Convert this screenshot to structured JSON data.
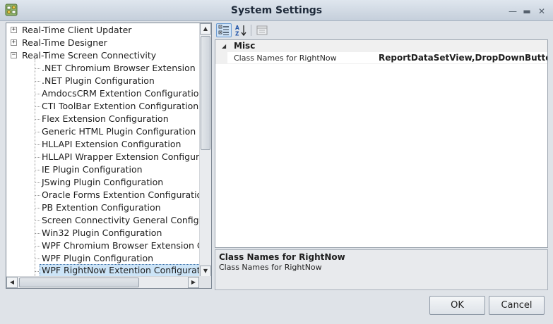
{
  "window": {
    "title": "System Settings",
    "controls": {
      "minimize": "—",
      "maximize": "▬",
      "close": "✕"
    }
  },
  "tree": {
    "items": [
      {
        "label": "Real-Time Client Updater",
        "level": 0,
        "expander": "+"
      },
      {
        "label": "Real-Time Designer",
        "level": 0,
        "expander": "+"
      },
      {
        "label": "Real-Time Screen Connectivity",
        "level": 0,
        "expander": "−"
      },
      {
        "label": ".NET Chromium Browser Extension",
        "level": 1
      },
      {
        "label": ".NET Plugin Configuration",
        "level": 1
      },
      {
        "label": "AmdocsCRM Extention Configuration",
        "level": 1
      },
      {
        "label": "CTI ToolBar Extention Configuration",
        "level": 1
      },
      {
        "label": "Flex Extension Configuration",
        "level": 1
      },
      {
        "label": "Generic HTML Plugin Configuration",
        "level": 1
      },
      {
        "label": "HLLAPI Extension Configuration",
        "level": 1
      },
      {
        "label": "HLLAPI Wrapper Extension Configur",
        "level": 1
      },
      {
        "label": "IE Plugin Configuration",
        "level": 1
      },
      {
        "label": "JSwing Plugin Configuration",
        "level": 1
      },
      {
        "label": "Oracle Forms Extention Configuratio",
        "level": 1
      },
      {
        "label": "PB Extention Configuration",
        "level": 1
      },
      {
        "label": "Screen Connectivity General Configu",
        "level": 1
      },
      {
        "label": "Win32 Plugin Configuration",
        "level": 1
      },
      {
        "label": "WPF Chromium Browser Extension C",
        "level": 1
      },
      {
        "label": "WPF Plugin Configuration",
        "level": 1
      },
      {
        "label": "WPF RightNow Extention Configurati",
        "level": 1,
        "selected": true
      }
    ],
    "scroll": {
      "up": "▲",
      "down": "▼",
      "left": "◀",
      "right": "▶"
    }
  },
  "property_grid": {
    "category": {
      "toggle": "◢",
      "name": "Misc"
    },
    "row": {
      "name": "Class Names for RightNow",
      "value": "ReportDataSetView,DropDownButton,TabControl"
    }
  },
  "description": {
    "title": "Class Names for RightNow",
    "text": "Class Names for RightNow"
  },
  "buttons": {
    "ok": "OK",
    "cancel": "Cancel"
  },
  "colors": {
    "selection": "#cce4f7",
    "titlebar": "#c5cfdb",
    "accent": "#6b9bd1"
  }
}
